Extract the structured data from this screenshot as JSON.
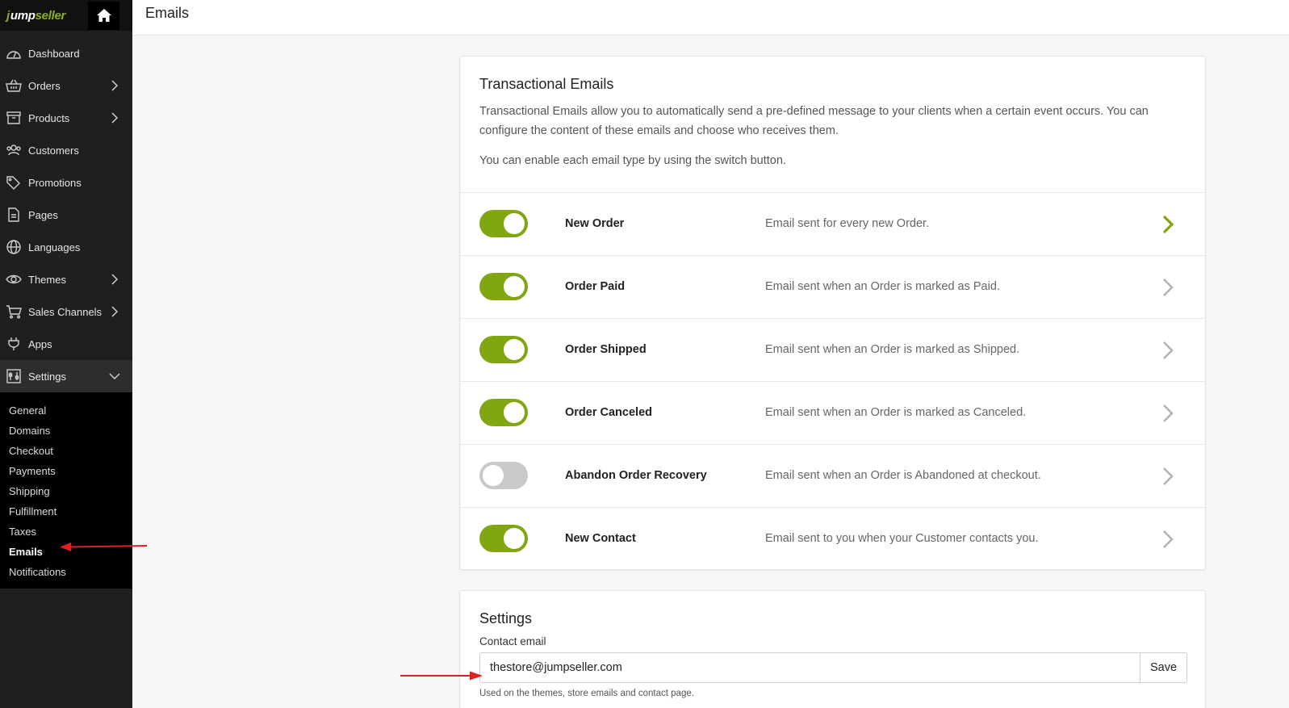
{
  "brand": {
    "logo_j": "j",
    "logo_mid": "ump",
    "logo_end": "seller",
    "accent": "#80a612"
  },
  "header": {
    "title": "Emails"
  },
  "sidebar": {
    "items": [
      {
        "label": "Dashboard",
        "icon": "speedometer-icon",
        "has_chevron": false
      },
      {
        "label": "Orders",
        "icon": "basket-icon",
        "has_chevron": true
      },
      {
        "label": "Products",
        "icon": "box-icon",
        "has_chevron": true
      },
      {
        "label": "Customers",
        "icon": "users-icon",
        "has_chevron": false
      },
      {
        "label": "Promotions",
        "icon": "tags-icon",
        "has_chevron": false
      },
      {
        "label": "Pages",
        "icon": "page-icon",
        "has_chevron": false
      },
      {
        "label": "Languages",
        "icon": "globe-icon",
        "has_chevron": false
      },
      {
        "label": "Themes",
        "icon": "eye-icon",
        "has_chevron": true
      },
      {
        "label": "Sales Channels",
        "icon": "cart-icon",
        "has_chevron": true
      },
      {
        "label": "Apps",
        "icon": "plug-icon",
        "has_chevron": false
      },
      {
        "label": "Settings",
        "icon": "settings-icon",
        "has_chevron": true,
        "expanded": true
      }
    ],
    "settings_sub": [
      "General",
      "Domains",
      "Checkout",
      "Payments",
      "Shipping",
      "Fulfillment",
      "Taxes",
      "Emails",
      "Notifications"
    ],
    "current_sub": "Emails"
  },
  "transactional": {
    "title": "Transactional Emails",
    "description": "Transactional Emails allow you to automatically send a pre-defined message to your clients when a certain event occurs. You can configure the content of these emails and choose who receives them.",
    "hint": "You can enable each email type by using the switch button.",
    "rows": [
      {
        "name": "New Order",
        "desc": "Email sent for every new Order.",
        "enabled": true,
        "highlight": true
      },
      {
        "name": "Order Paid",
        "desc": "Email sent when an Order is marked as Paid.",
        "enabled": true
      },
      {
        "name": "Order Shipped",
        "desc": "Email sent when an Order is marked as Shipped.",
        "enabled": true
      },
      {
        "name": "Order Canceled",
        "desc": "Email sent when an Order is marked as Canceled.",
        "enabled": true
      },
      {
        "name": "Abandon Order Recovery",
        "desc": "Email sent when an Order is Abandoned at checkout.",
        "enabled": false
      },
      {
        "name": "New Contact",
        "desc": "Email sent to you when your Customer contacts you.",
        "enabled": true
      }
    ]
  },
  "settings": {
    "title": "Settings",
    "contact_label": "Contact email",
    "contact_value": "thestore@jumpseller.com",
    "save_label": "Save",
    "help": "Used on the themes, store emails and contact page."
  },
  "colors": {
    "annotation": "#e02020",
    "chevron_active": "#80a612",
    "chevron_idle": "#b0b0b4"
  }
}
